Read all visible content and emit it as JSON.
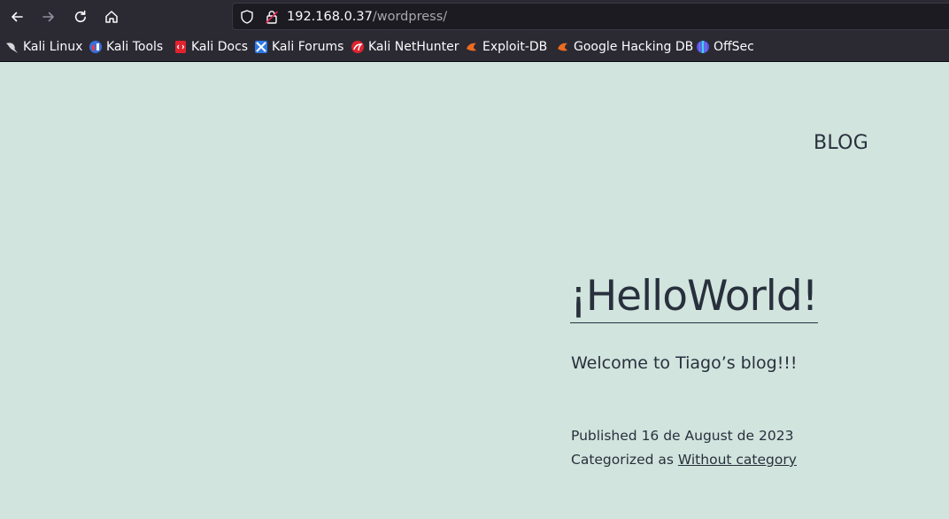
{
  "browser": {
    "url": {
      "host": "192.168.0.37",
      "path": "/wordpress/"
    },
    "bookmarks": [
      {
        "label": "Kali Linux",
        "icon": "kali-dragon-icon"
      },
      {
        "label": "Kali Tools",
        "icon": "kali-tools-icon"
      },
      {
        "label": "Kali Docs",
        "icon": "kali-docs-icon"
      },
      {
        "label": "Kali Forums",
        "icon": "kali-forums-icon"
      },
      {
        "label": "Kali NetHunter",
        "icon": "kali-nethunter-icon"
      },
      {
        "label": "Exploit-DB",
        "icon": "exploit-db-icon"
      },
      {
        "label": "Google Hacking DB",
        "icon": "google-hacking-db-icon"
      },
      {
        "label": "OffSec",
        "icon": "offsec-icon"
      }
    ],
    "colors": {
      "toolbar": "#2b2a33",
      "urlbar": "#1c1b22",
      "text": "#fbfbfe"
    }
  },
  "site": {
    "title": "BLOG",
    "background": "#d1e4dd",
    "text_color": "#28303d"
  },
  "post": {
    "title": "¡HelloWorld!",
    "excerpt": "Welcome to Tiago’s blog!!!",
    "published_label": "Published",
    "published_date": "16 de August de 2023",
    "category_label": "Categorized as",
    "category": "Without category"
  }
}
